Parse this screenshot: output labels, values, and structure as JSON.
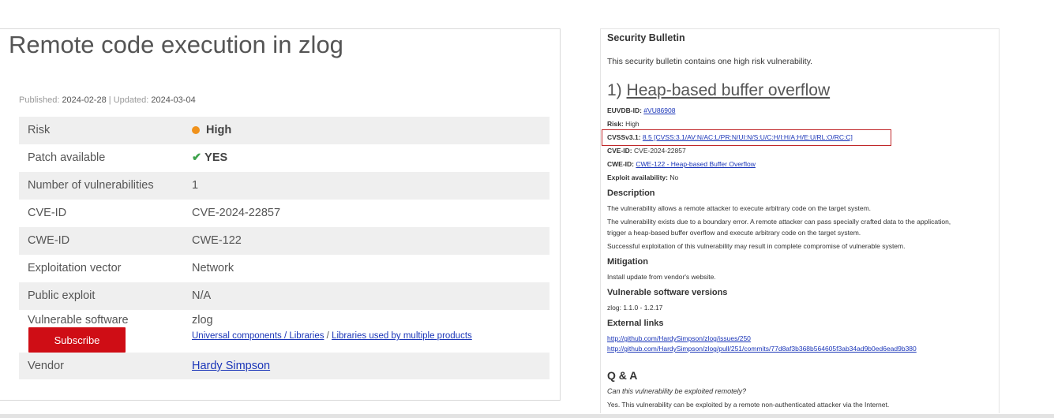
{
  "left": {
    "title": "Remote code execution in zlog",
    "published_label": "Published:",
    "published_value": "2024-02-28",
    "separator": "|",
    "updated_label": "Updated:",
    "updated_value": "2024-03-04",
    "rows": {
      "risk": {
        "label": "Risk",
        "value": "High",
        "color": "#f0921c"
      },
      "patch": {
        "label": "Patch available",
        "value": "YES",
        "check": "✔"
      },
      "num_vulns": {
        "label": "Number of vulnerabilities",
        "value": "1"
      },
      "cve": {
        "label": "CVE-ID",
        "value": "CVE-2024-22857"
      },
      "cwe": {
        "label": "CWE-ID",
        "value": "CWE-122"
      },
      "vector": {
        "label": "Exploitation vector",
        "value": "Network"
      },
      "public_exploit": {
        "label": "Public exploit",
        "value": "N/A"
      },
      "software": {
        "label": "Vulnerable software",
        "value": "zlog",
        "link1": "Universal components / Libraries",
        "link_sep": "/",
        "link2": "Libraries used by multiple products"
      },
      "vendor": {
        "label": "Vendor",
        "value": "Hardy Simpson"
      }
    },
    "subscribe_label": "Subscribe"
  },
  "right": {
    "heading": "Security Bulletin",
    "intro": "This security bulletin contains one high risk vulnerability.",
    "vuln_number": "1)",
    "vuln_title": "Heap-based buffer overflow",
    "euvdb_label": "EUVDB-ID:",
    "euvdb_value": "#VU86908",
    "risk_label": "Risk:",
    "risk_value": "High",
    "cvss_label": "CVSSv3.1:",
    "cvss_value": "8.5 [CVSS:3.1/AV:N/AC:L/PR:N/UI:N/S:U/C:H/I:H/A:H/E:U/RL:O/RC:C]",
    "cve_label": "CVE-ID:",
    "cve_value": "CVE-2024-22857",
    "cwe_label": "CWE-ID:",
    "cwe_value": "CWE-122 - Heap-based Buffer Overflow",
    "exploit_label": "Exploit availability:",
    "exploit_value": "No",
    "description_heading": "Description",
    "desc1": "The vulnerability allows a remote attacker to execute arbitrary code on the target system.",
    "desc2a": "The vulnerability exists due to a boundary error. A remote attacker can pass specially crafted data to the application,",
    "desc2b": "trigger a heap-based buffer overflow and execute arbitrary code on the target system.",
    "desc3": "Successful exploitation of this vulnerability may result in complete compromise of vulnerable system.",
    "mitigation_heading": "Mitigation",
    "mitigation_text": "Install update from vendor's website.",
    "versions_heading": "Vulnerable software versions",
    "versions_text": "zlog: 1.1.0 - 1.2.17",
    "links_heading": "External links",
    "link1": "http://github.com/HardySimpson/zlog/issues/250",
    "link2": "http://github.com/HardySimpson/zlog/pull/251/commits/77d8af3b368b564605f3ab34ad9b0ed6ead9b380",
    "qa_heading": "Q & A",
    "qa_question": "Can this vulnerability be exploited remotely?",
    "qa_answer": "Yes. This vulnerability can be exploited by a remote non-authenticated attacker via the Internet."
  }
}
